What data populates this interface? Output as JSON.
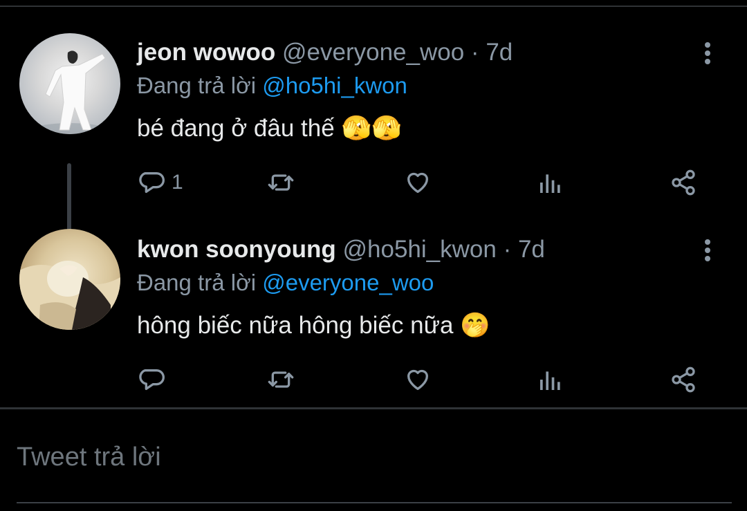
{
  "tweets": [
    {
      "display_name": "jeon wowoo",
      "handle": "@everyone_woo",
      "separator": "·",
      "time": "7d",
      "reply_prefix": "Đang trả lời",
      "reply_to": "@ho5hi_kwon",
      "text": "bé đang ở đâu thế",
      "emoji": "🫣🫣",
      "reply_count": "1",
      "avatar_icon": "avatar-photo"
    },
    {
      "display_name": "kwon soonyoung",
      "handle": "@ho5hi_kwon",
      "separator": "·",
      "time": "7d",
      "reply_prefix": "Đang trả lời",
      "reply_to": "@everyone_woo",
      "text": "hông biếc nữa hông biếc nữa",
      "emoji": "🤭",
      "reply_count": "",
      "avatar_icon": "avatar-photo"
    }
  ],
  "compose": {
    "placeholder": "Tweet trả lời"
  },
  "colors": {
    "background": "#000000",
    "primary_text": "#e7e9ea",
    "secondary_text": "#8b98a5",
    "link": "#1d9bf0",
    "divider": "#2f3336"
  },
  "icons": {
    "reply": "reply-bubble-icon",
    "retweet": "retweet-icon",
    "like": "heart-icon",
    "stats": "analytics-icon",
    "share": "share-icon",
    "more": "more-vertical-icon"
  }
}
